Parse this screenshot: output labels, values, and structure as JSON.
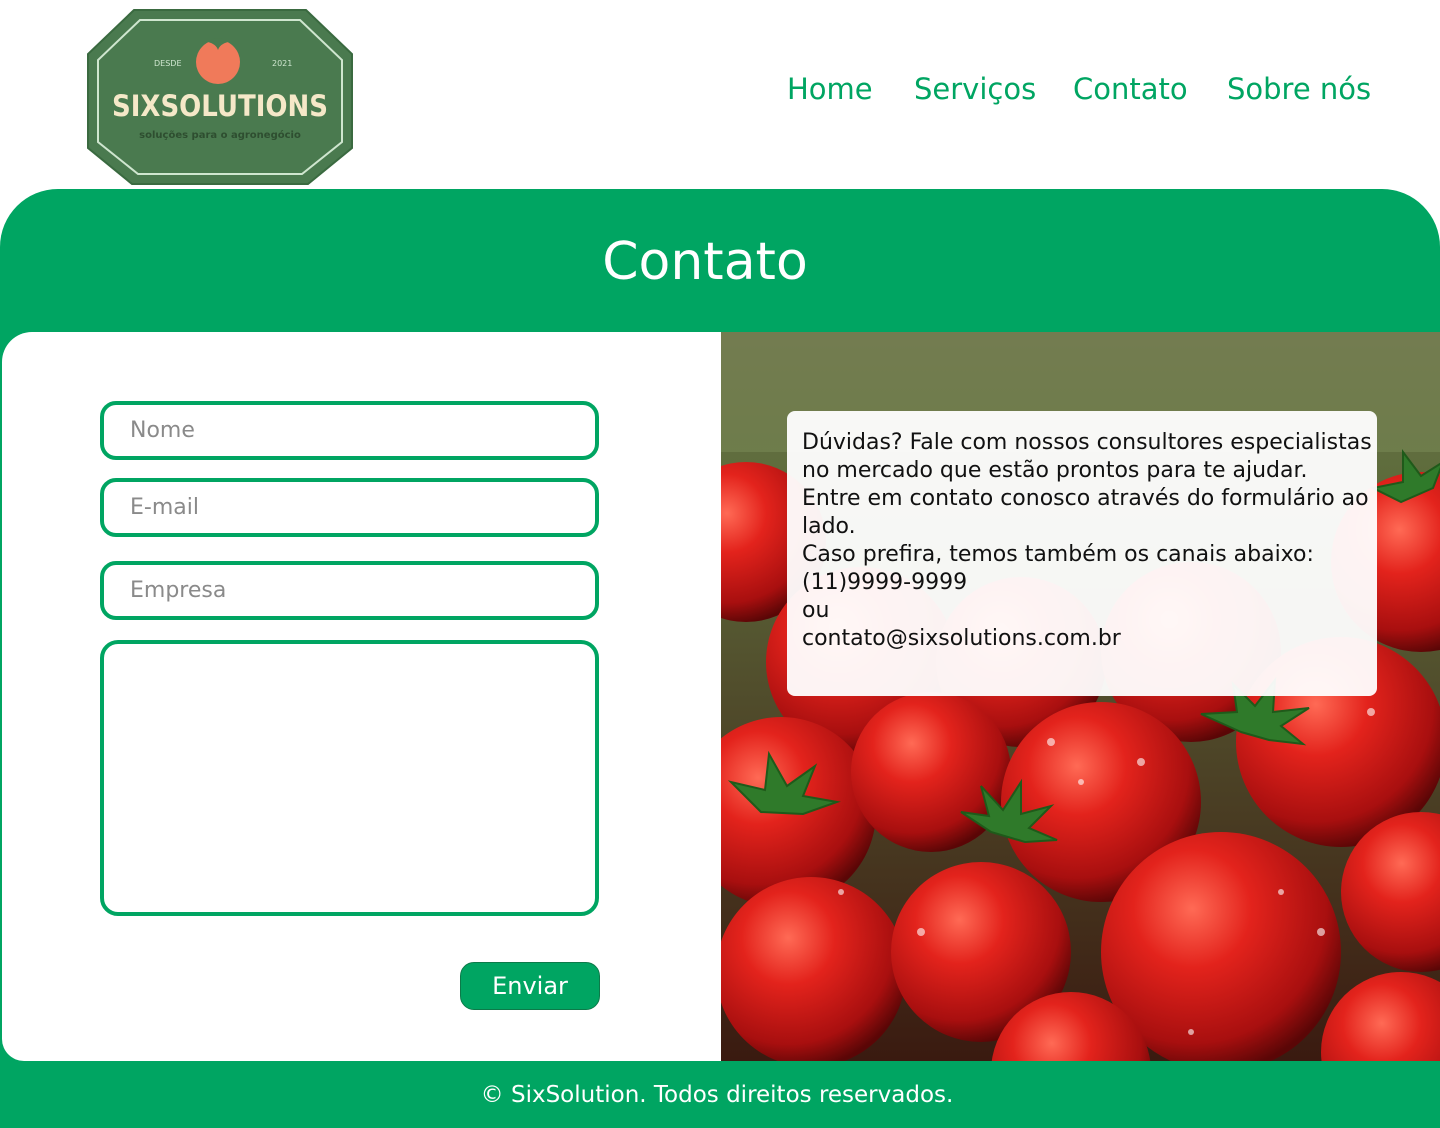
{
  "brand": {
    "name": "SIXSOLUTIONS",
    "tagline": "soluções para o agronegócio",
    "since_label": "DESDE",
    "since_year": "2021",
    "colors": {
      "primary": "#00a562",
      "logo_bg": "#4a7a4f",
      "logo_text": "#f5e8c8",
      "tomato": "#f07a5a"
    }
  },
  "nav": {
    "items": [
      {
        "label": "Home"
      },
      {
        "label": "Serviços"
      },
      {
        "label": "Contato"
      },
      {
        "label": "Sobre nós"
      }
    ]
  },
  "page": {
    "title": "Contato"
  },
  "form": {
    "name_placeholder": "Nome",
    "email_placeholder": "E-mail",
    "company_placeholder": "Empresa",
    "message_placeholder": "",
    "submit_label": "Enviar"
  },
  "info": {
    "lines": [
      "Dúvidas? Fale com nossos consultores especialistas",
      "no mercado que estão prontos para te ajudar.",
      "Entre em contato conosco através do formulário ao",
      "lado.",
      "Caso prefira, temos também os canais abaixo:",
      "(11)9999-9999",
      "ou",
      "contato@sixsolutions.com.br"
    ]
  },
  "photo": {
    "subject": "tomatoes-photo"
  },
  "footer": {
    "text": "© SixSolution. Todos direitos reservados."
  }
}
